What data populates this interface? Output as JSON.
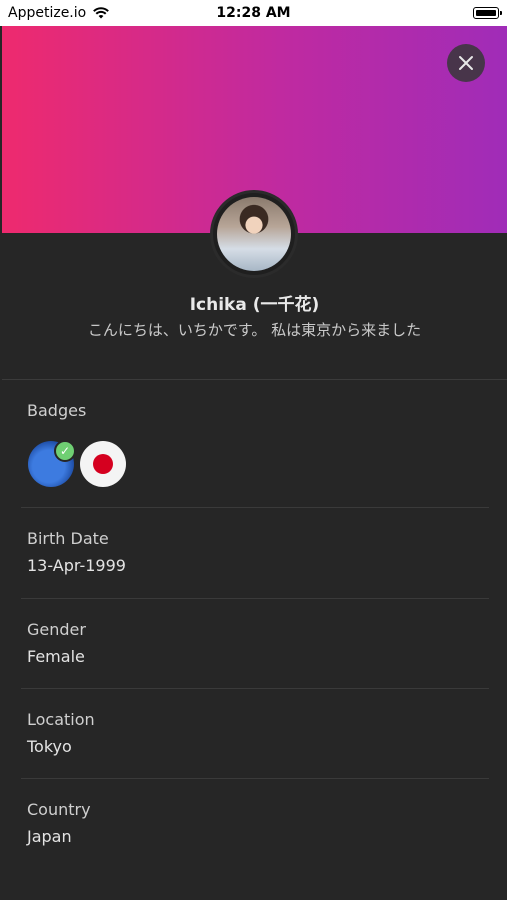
{
  "status_bar": {
    "carrier": "Appetize.io",
    "time": "12:28 AM"
  },
  "profile": {
    "name": "Ichika (一千花)",
    "bio": "こんにちは、いちかです。 私は東京から来ました"
  },
  "badges": {
    "label": "Badges",
    "items": [
      {
        "icon": "verified-badge-icon"
      },
      {
        "icon": "japan-flag-icon"
      }
    ]
  },
  "details": [
    {
      "label": "Birth Date",
      "value": "13-Apr-1999"
    },
    {
      "label": "Gender",
      "value": "Female"
    },
    {
      "label": "Location",
      "value": "Tokyo"
    },
    {
      "label": "Country",
      "value": "Japan"
    }
  ],
  "colors": {
    "gradient_start": "#ee2a6e",
    "gradient_end": "#a02cb8",
    "background": "#262626"
  }
}
